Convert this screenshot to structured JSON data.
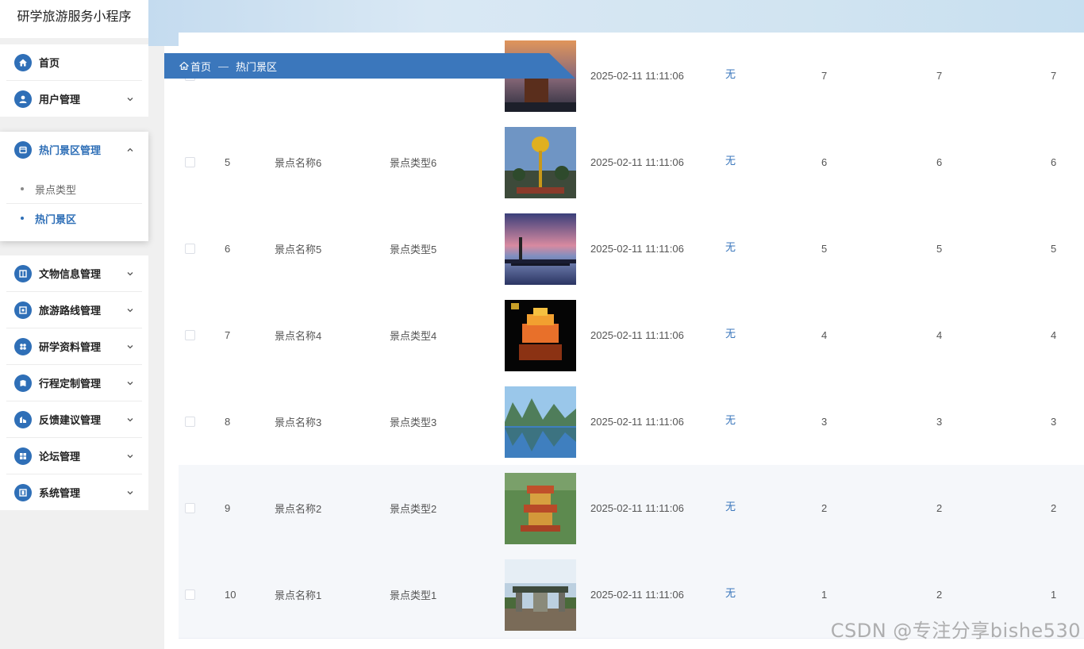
{
  "app": {
    "title": "研学旅游服务小程序"
  },
  "sidebar": {
    "top_items": [
      {
        "label": "首页",
        "icon": "home-icon",
        "has_chevron": false
      },
      {
        "label": "用户管理",
        "icon": "user-icon",
        "has_chevron": true
      }
    ],
    "expanded": {
      "label": "热门景区管理",
      "icon": "scenic-icon",
      "children": [
        {
          "label": "景点类型",
          "active": false
        },
        {
          "label": "热门景区",
          "active": true
        }
      ]
    },
    "bottom_items": [
      {
        "label": "文物信息管理",
        "icon": "book-icon"
      },
      {
        "label": "旅游路线管理",
        "icon": "route-icon"
      },
      {
        "label": "研学资料管理",
        "icon": "grid-icon"
      },
      {
        "label": "行程定制管理",
        "icon": "calendar-icon"
      },
      {
        "label": "反馈建议管理",
        "icon": "feedback-icon"
      },
      {
        "label": "论坛管理",
        "icon": "forum-icon"
      },
      {
        "label": "系统管理",
        "icon": "settings-icon"
      }
    ]
  },
  "breadcrumb": {
    "home": "首页",
    "separator": "—",
    "current": "热门景区"
  },
  "table": {
    "rows": [
      {
        "id": "",
        "name": "",
        "type": "",
        "time": "2025-02-11 11:11:06",
        "link": "无",
        "c1": "7",
        "c2": "7",
        "c3": "7",
        "img": "tower-dusk",
        "partial": true
      },
      {
        "id": "5",
        "name": "景点名称6",
        "type": "景点类型6",
        "time": "2025-02-11 11:11:06",
        "link": "无",
        "c1": "6",
        "c2": "6",
        "c3": "6",
        "img": "golden-lotus",
        "partial": false
      },
      {
        "id": "6",
        "name": "景点名称5",
        "type": "景点类型5",
        "time": "2025-02-11 11:11:06",
        "link": "无",
        "c1": "5",
        "c2": "5",
        "c3": "5",
        "img": "lake-sunset",
        "partial": false
      },
      {
        "id": "7",
        "name": "景点名称4",
        "type": "景点类型4",
        "time": "2025-02-11 11:11:06",
        "link": "无",
        "c1": "4",
        "c2": "4",
        "c3": "4",
        "img": "lit-pavilion",
        "partial": false
      },
      {
        "id": "8",
        "name": "景点名称3",
        "type": "景点类型3",
        "time": "2025-02-11 11:11:06",
        "link": "无",
        "c1": "3",
        "c2": "3",
        "c3": "3",
        "img": "karst-river",
        "partial": false
      },
      {
        "id": "9",
        "name": "景点名称2",
        "type": "景点类型2",
        "time": "2025-02-11 11:11:06",
        "link": "无",
        "c1": "2",
        "c2": "2",
        "c3": "2",
        "img": "yellow-crane",
        "partial": false
      },
      {
        "id": "10",
        "name": "景点名称1",
        "type": "景点类型1",
        "time": "2025-02-11 11:11:06",
        "link": "无",
        "c1": "1",
        "c2": "2",
        "c3": "1",
        "img": "gate-arch",
        "partial": false
      }
    ]
  },
  "watermark": "CSDN @专注分享bishe530",
  "colors": {
    "primary": "#3b77bc",
    "icon_bg": "#2f6fb7",
    "row_stripe": "#f5f7fa"
  }
}
